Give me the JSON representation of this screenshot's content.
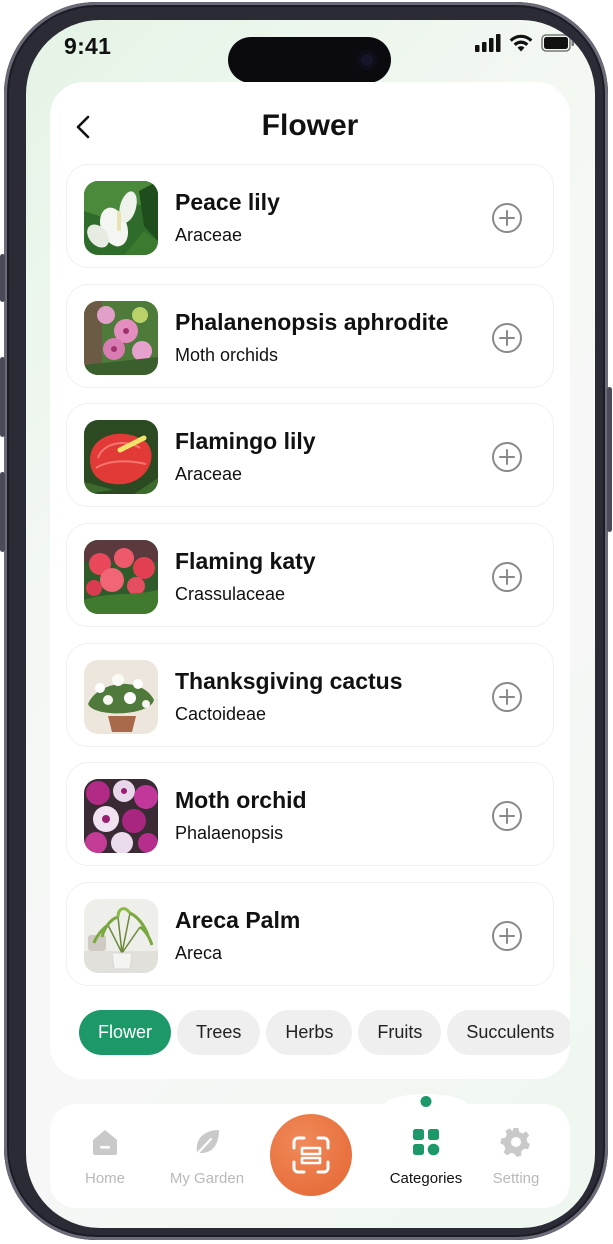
{
  "status_bar": {
    "time": "9:41"
  },
  "header": {
    "title": "Flower"
  },
  "plants": [
    {
      "name": "Peace lily",
      "family": "Araceae",
      "thumb": "peace-lily-photo"
    },
    {
      "name": "Phalanenopsis aphrodite",
      "family": "Moth orchids",
      "thumb": "phalaenopsis-photo"
    },
    {
      "name": "Flamingo lily",
      "family": "Araceae",
      "thumb": "flamingo-lily-photo"
    },
    {
      "name": "Flaming katy",
      "family": "Crassulaceae",
      "thumb": "flaming-katy-photo"
    },
    {
      "name": "Thanksgiving cactus",
      "family": "Cactoideae",
      "thumb": "thanksgiving-cactus-photo"
    },
    {
      "name": "Moth orchid",
      "family": "Phalaenopsis",
      "thumb": "moth-orchid-photo"
    },
    {
      "name": "Areca Palm",
      "family": "Areca",
      "thumb": "areca-palm-photo"
    }
  ],
  "categories": {
    "selected": "Flower",
    "items": [
      "Flower",
      "Trees",
      "Herbs",
      "Fruits",
      "Succulents"
    ]
  },
  "nav": {
    "items": [
      {
        "label": "Home",
        "icon": "home-icon"
      },
      {
        "label": "My Garden",
        "icon": "leaf-icon"
      },
      {
        "label": "",
        "icon": "scan-icon"
      },
      {
        "label": "Categories",
        "icon": "grid-icon"
      },
      {
        "label": "Setting",
        "icon": "gear-icon"
      }
    ],
    "active": "Categories"
  },
  "colors": {
    "accent_green": "#1d9868",
    "scan_orange": "#e8703d",
    "chip_bg": "#efefef"
  }
}
